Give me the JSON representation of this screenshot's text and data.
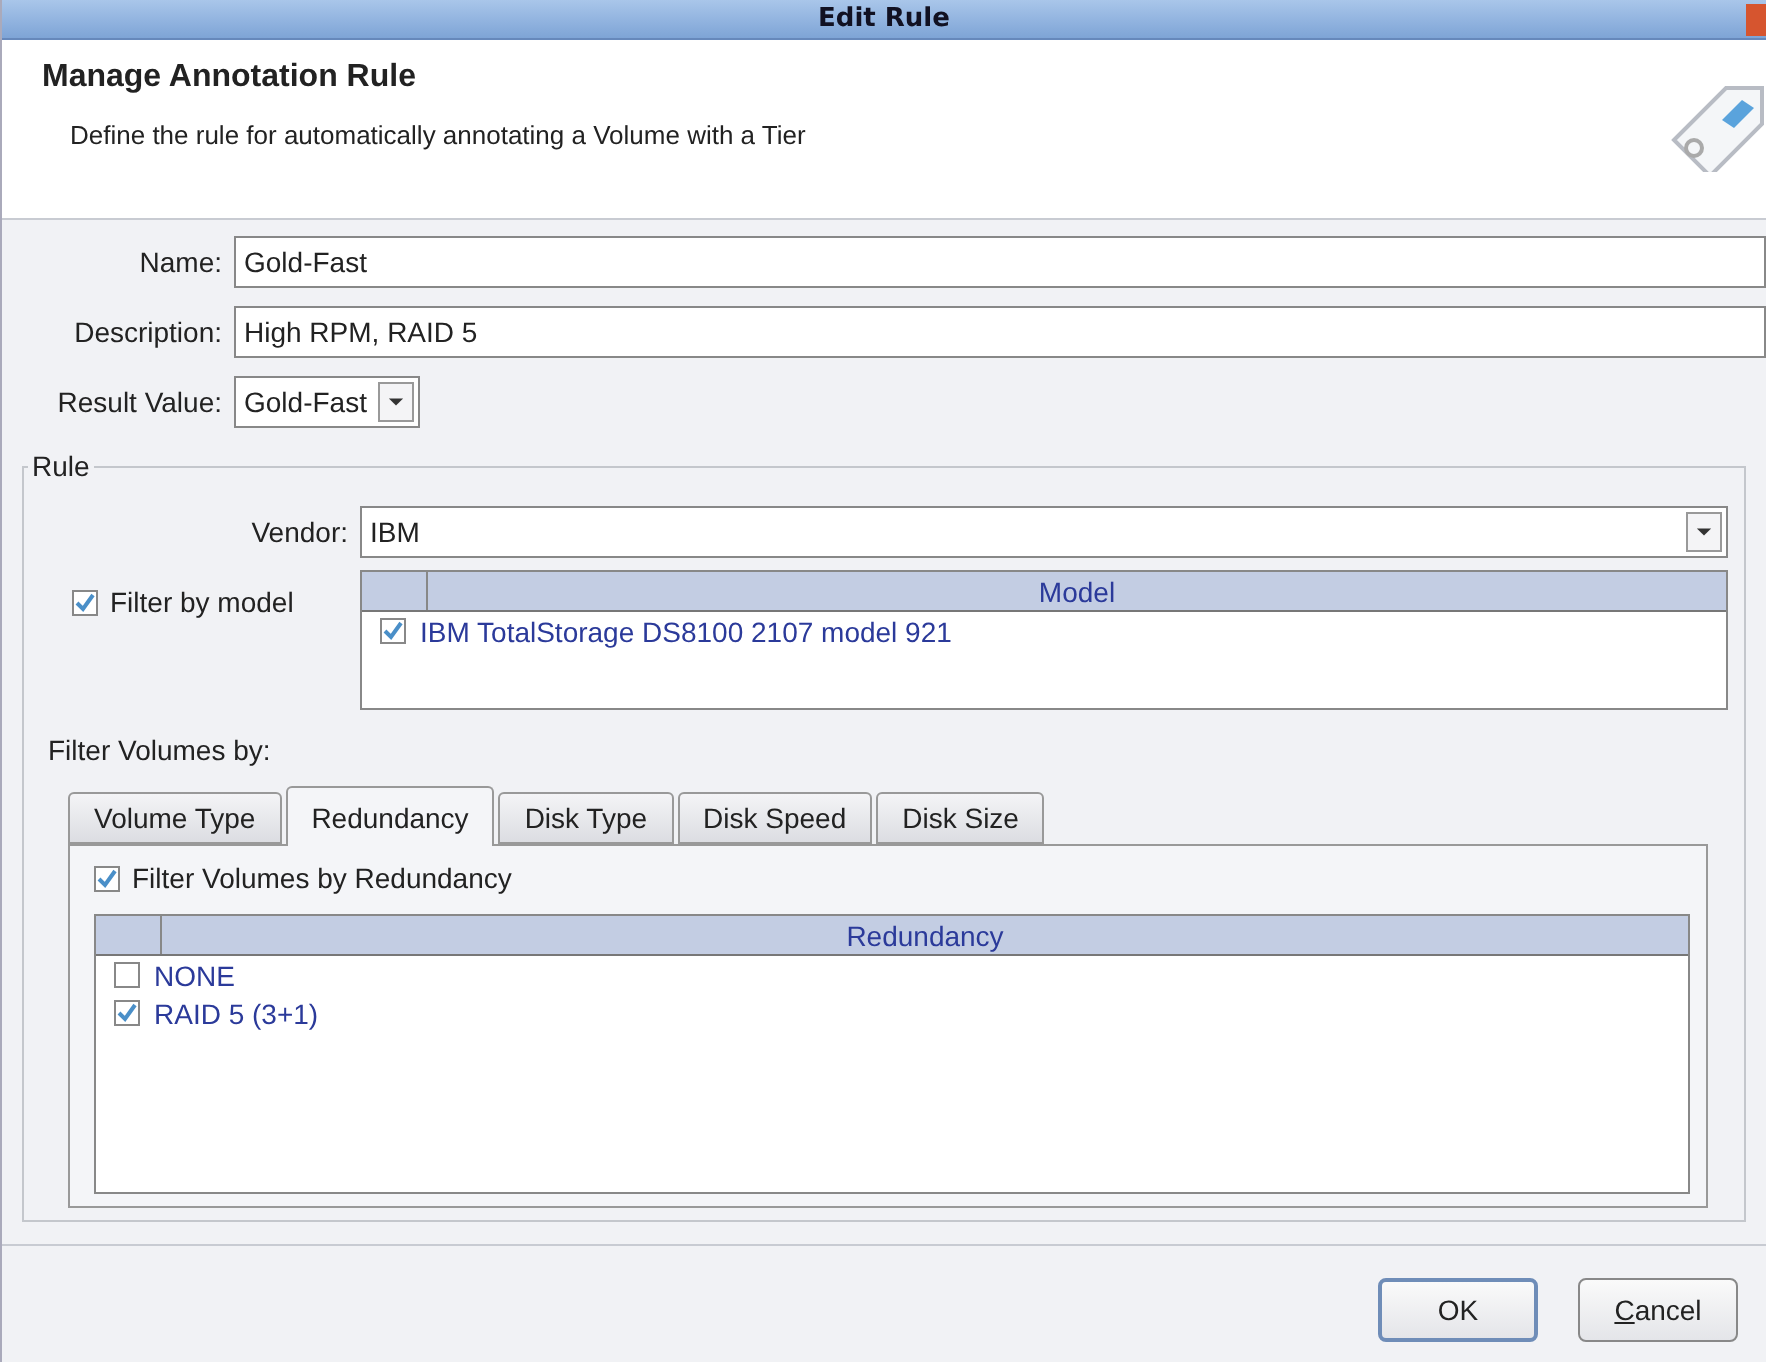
{
  "window": {
    "title": "Edit Rule"
  },
  "header": {
    "title": "Manage Annotation Rule",
    "subtitle": "Define the rule for automatically annotating a Volume with a Tier"
  },
  "fields": {
    "name": {
      "label": "Name:",
      "value": "Gold-Fast"
    },
    "description": {
      "label": "Description:",
      "value": "High RPM, RAID 5"
    },
    "result_value": {
      "label": "Result Value:",
      "value": "Gold-Fast"
    }
  },
  "rule": {
    "legend": "Rule",
    "vendor": {
      "label": "Vendor:",
      "value": "IBM"
    },
    "filter_by_model": {
      "label": "Filter by model",
      "checked": true
    },
    "model_table": {
      "column": "Model",
      "rows": [
        {
          "label": "IBM TotalStorage DS8100 2107 model 921",
          "checked": true
        }
      ]
    },
    "filter_volumes_label": "Filter Volumes by:",
    "tabs": [
      {
        "label": "Volume Type",
        "selected": false
      },
      {
        "label": "Redundancy",
        "selected": true
      },
      {
        "label": "Disk Type",
        "selected": false
      },
      {
        "label": "Disk Speed",
        "selected": false
      },
      {
        "label": "Disk Size",
        "selected": false
      }
    ],
    "tab_panel": {
      "filter": {
        "label": "Filter Volumes by Redundancy",
        "checked": true
      },
      "table": {
        "column": "Redundancy",
        "rows": [
          {
            "label": "NONE",
            "checked": false
          },
          {
            "label": "RAID 5 (3+1)",
            "checked": true
          }
        ]
      }
    }
  },
  "buttons": [
    {
      "label": "OK",
      "default": true
    },
    {
      "label": "Cancel",
      "mnemonic": true,
      "default": false
    }
  ]
}
